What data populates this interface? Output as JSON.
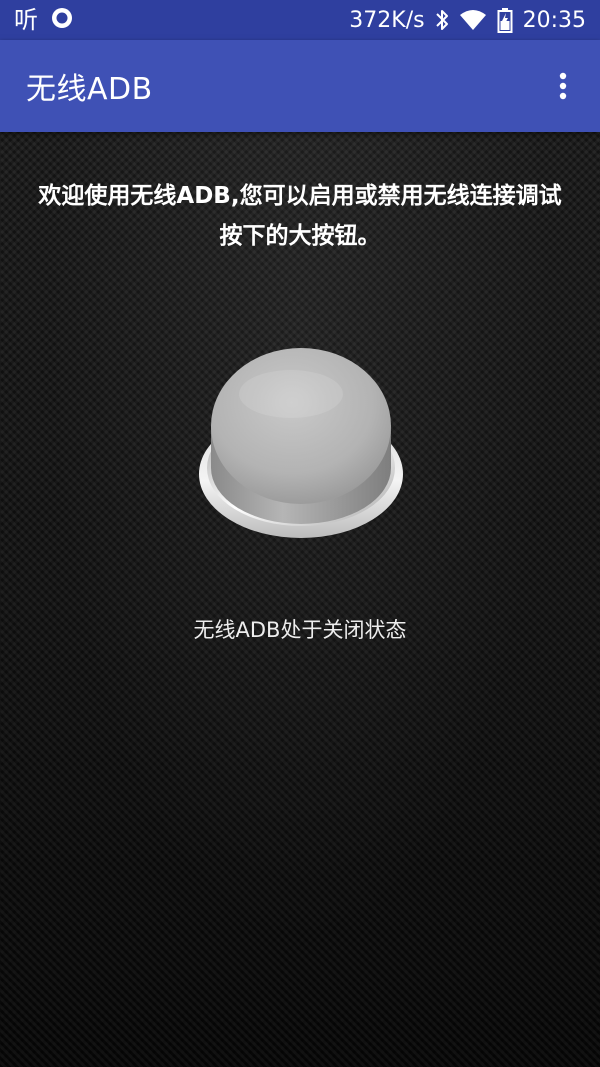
{
  "status_bar": {
    "app_glyph": "听",
    "net_speed": "372K/s",
    "time": "20:35",
    "icons": [
      "ting-app-icon",
      "record-circle-icon",
      "bluetooth-icon",
      "wifi-icon",
      "battery-icon"
    ]
  },
  "app_bar": {
    "title": "无线ADB",
    "overflow_icon": "more-vert-icon"
  },
  "main": {
    "welcome_text": "欢迎使用无线ADB,您可以启用或禁用无线连接调试按下的大按钮。",
    "toggle_icon": "big-push-button-icon",
    "status_text": "无线ADB处于关闭状态"
  },
  "colors": {
    "status_bar": "#2f3f9f",
    "app_bar": "#3f51b5",
    "background": "#141414",
    "text": "#ffffff"
  }
}
